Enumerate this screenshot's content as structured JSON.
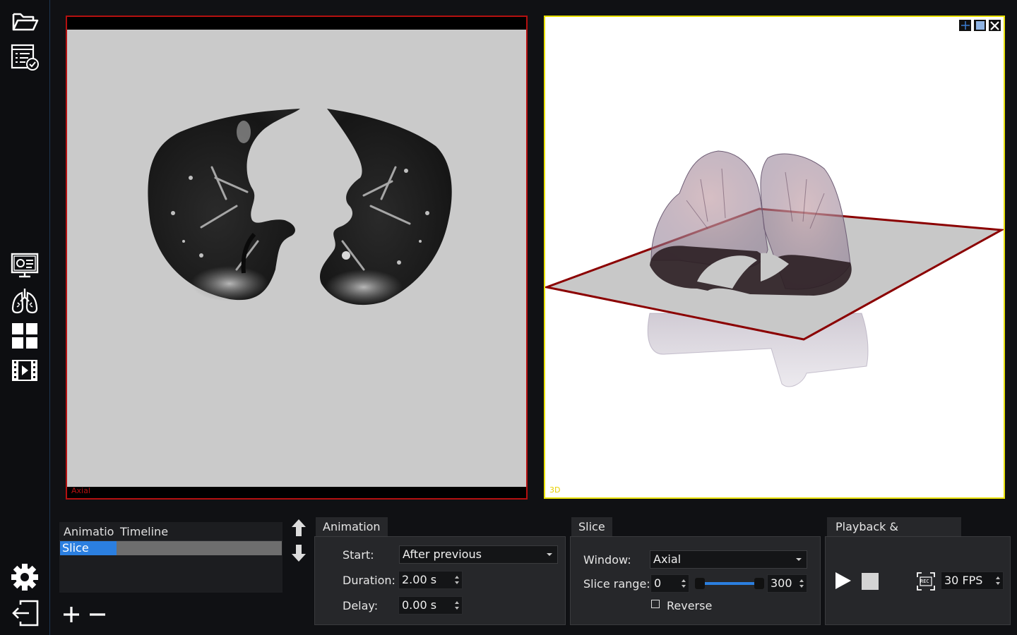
{
  "sidebar": {
    "icons": [
      "folder-open-icon",
      "checklist-icon",
      "monitor-settings-icon",
      "lungs-icon",
      "grid-icon",
      "film-icon",
      "gear-icon",
      "logout-icon"
    ]
  },
  "viewports": {
    "axial_label": "Axial",
    "three_d_label": "3D",
    "axial_border_color": "#b41010",
    "three_d_border_color": "#e8e000"
  },
  "animation_list": {
    "columns": [
      "Animatio",
      "Timeline"
    ],
    "rows": [
      {
        "name": "Slice"
      }
    ]
  },
  "animation_panel": {
    "tab": "Animation",
    "start_label": "Start:",
    "start_value": "After previous",
    "duration_label": "Duration:",
    "duration_value": "2.00 s",
    "delay_label": "Delay:",
    "delay_value": "0.00 s"
  },
  "slice_panel": {
    "tab": "Slice",
    "window_label": "Window:",
    "window_value": "Axial",
    "range_label": "Slice range:",
    "range_min": "0",
    "range_max": "300",
    "reverse_label": "Reverse",
    "reverse_checked": false
  },
  "playback_panel": {
    "tab": "Playback & Recording",
    "fps_value": "30 FPS",
    "rec_label": "REC"
  },
  "colors": {
    "accent": "#2b7fe0",
    "plane_edge": "#8b0000"
  }
}
